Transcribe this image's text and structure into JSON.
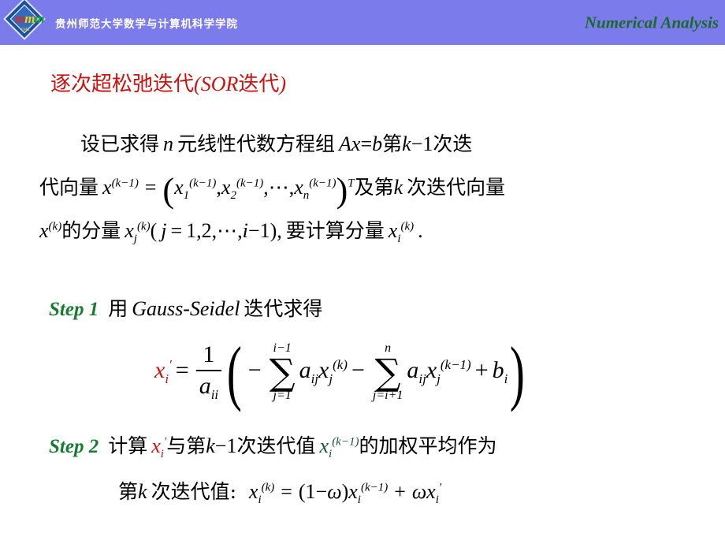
{
  "header": {
    "school_name": "贵州师范大学数学与计算机科学学院",
    "course_title": "Numerical Analysis",
    "band_color": "#7b7beb",
    "course_color": "#1a6b2a",
    "logo": {
      "name": "gznu-emblem-logo",
      "letters": [
        "\u0001",
        "\u0002",
        "\u0003"
      ],
      "letter_text": "m",
      "year": "1941"
    }
  },
  "slide": {
    "title_cn_1": "逐次超松弛迭代",
    "title_paren_open": "(",
    "title_latin": "SOR",
    "title_cn_2": "迭代",
    "title_paren_close": ")",
    "title_color": "#cc1111"
  },
  "body": {
    "line1": {
      "t1": "设已求得",
      "m1": "n",
      "t2": "元线性代数方程组",
      "m2": "Ax",
      "eq": "=",
      "m3": "b",
      "t3": "第",
      "m4": "k",
      "minus": "−1",
      "t4": "次迭"
    },
    "line2": {
      "t1": "代向量",
      "x": "x",
      "sup_km1": "(k−1)",
      "eq": "=",
      "x1": "x",
      "sub1": "1",
      "comma1": ",",
      "x2": "x",
      "sub2": "2",
      "comma2": ",",
      "dots": "⋯",
      "comma3": ",",
      "xn": "x",
      "subn": "n",
      "supT": "T",
      "t2": "及第",
      "m_k": "k",
      "t3": "次迭代向量"
    },
    "line3": {
      "x": "x",
      "sup_k": "(k)",
      "t1": "的分量",
      "xj": "x",
      "subj": "j",
      "paren_open": "(",
      "j": "j",
      "eq": "=",
      "vals": "1,2,",
      "dots": "⋯",
      "comma": ",",
      "i": "i",
      "minus1": "−1",
      "paren_close": ")",
      "comma2": ",",
      "t2": "要计算分量",
      "xi": "x",
      "subi": "i",
      "period": "."
    }
  },
  "steps": [
    {
      "label": "Step 1",
      "text_cn_1": "用",
      "latin": "Gauss-Seidel",
      "text_cn_2": "迭代求得"
    },
    {
      "label": "Step 2",
      "text_cn_1": "计算",
      "x_prime": "x",
      "x_prime_sub": "i",
      "x_prime_mark": "′",
      "text_cn_2": "与第",
      "k": "k",
      "minus1": "−1",
      "text_cn_3": "次迭代值",
      "x2": "x",
      "x2_sub": "i",
      "x2_sup": "(k−1)",
      "text_cn_4": "的加权平均作为"
    }
  ],
  "formula": {
    "lhs_x": "x",
    "lhs_sub": "i",
    "lhs_prime": "′",
    "lhs_color": "#cc1111",
    "equals": "=",
    "frac_num": "1",
    "frac_den_a": "a",
    "frac_den_sub": "ii",
    "paren_open": "(",
    "minus1": "−",
    "sum1_upper": "i−1",
    "sum1_sigma": "∑",
    "sum1_lower": "j=1",
    "term1_a": "a",
    "term1_a_sub": "ij",
    "term1_x": "x",
    "term1_x_sub": "j",
    "term1_x_sup": "(k)",
    "minus2": "−",
    "sum2_upper": "n",
    "sum2_sigma": "∑",
    "sum2_lower": "j=i+1",
    "term2_a": "a",
    "term2_a_sub": "ij",
    "term2_x": "x",
    "term2_x_sub": "j",
    "term2_x_sup": "(k−1)",
    "plus": "+",
    "term3_b": "b",
    "term3_b_sub": "i",
    "paren_close": ")"
  },
  "last_line": {
    "t1": "第",
    "k": "k",
    "t2": "次迭代值:",
    "x_k": "x",
    "x_k_sub": "i",
    "x_k_sup": "(k)",
    "eq": "=",
    "rhs_open": "(1",
    "minus": "−",
    "omega": "ω",
    "rhs_close": ")",
    "x_km1": "x",
    "x_km1_sub": "i",
    "x_km1_sup": "(k−1)",
    "plus": "+",
    "omega2": "ω",
    "x_prime": "x",
    "x_prime_sub": "i",
    "x_prime_mark": "′"
  }
}
